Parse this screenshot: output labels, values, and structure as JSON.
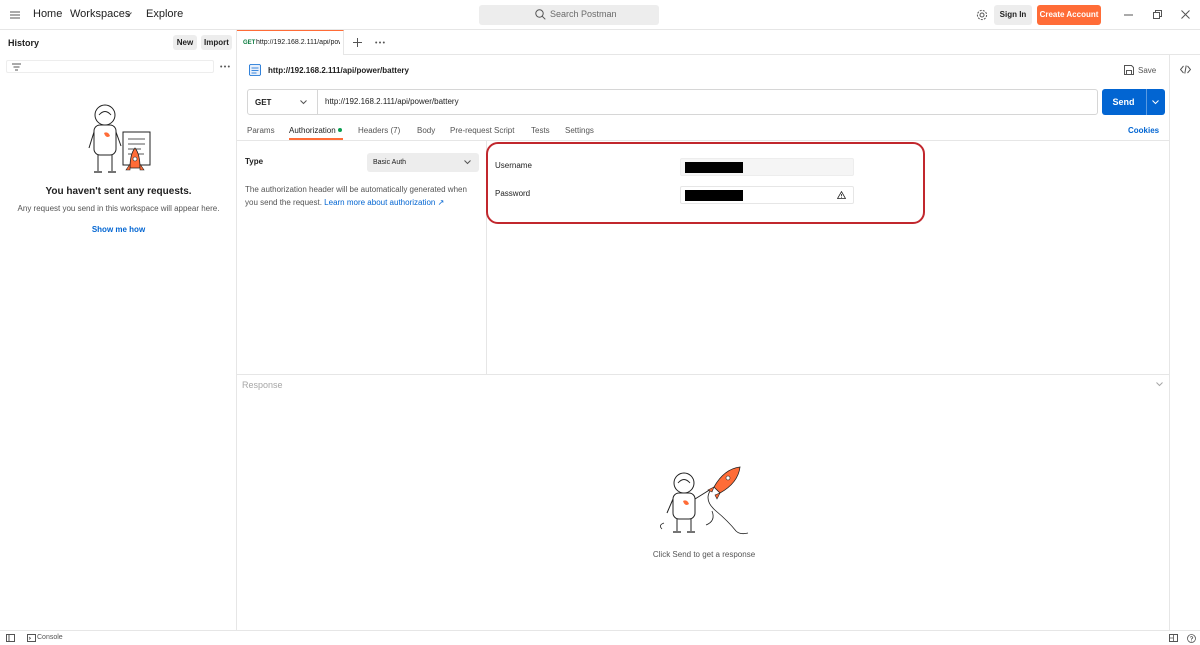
{
  "topbar": {
    "home": "Home",
    "workspaces": "Workspaces",
    "explore": "Explore",
    "search_placeholder": "Search Postman",
    "sign_in": "Sign In",
    "create_account": "Create Account"
  },
  "sidebar": {
    "title": "History",
    "new_label": "New",
    "import_label": "Import",
    "empty_title": "You haven't sent any requests.",
    "empty_subtitle": "Any request you send in this workspace will appear here.",
    "show_me_how": "Show me how"
  },
  "tabs": [
    {
      "method": "GET",
      "url": "http://192.168.2.111/api/power/battery"
    }
  ],
  "request": {
    "title": "http://192.168.2.111/api/power/battery",
    "save_label": "Save",
    "method": "GET",
    "url": "http://192.168.2.111/api/power/battery",
    "send_label": "Send",
    "tabs": {
      "params": "Params",
      "authorization": "Authorization",
      "headers": "Headers (7)",
      "body": "Body",
      "pre_request": "Pre-request Script",
      "tests": "Tests",
      "settings": "Settings"
    },
    "cookies": "Cookies"
  },
  "auth": {
    "type_label": "Type",
    "type_value": "Basic Auth",
    "description": "The authorization header will be automatically generated when you send the request. ",
    "learn_more": "Learn more about authorization ↗",
    "username_label": "Username",
    "password_label": "Password"
  },
  "response": {
    "title": "Response",
    "message": "Click Send to get a response"
  },
  "statusbar": {
    "console": "Console"
  },
  "colors": {
    "accent": "#ff6c37",
    "primary": "#0265d2",
    "highlight": "#c1272d"
  }
}
